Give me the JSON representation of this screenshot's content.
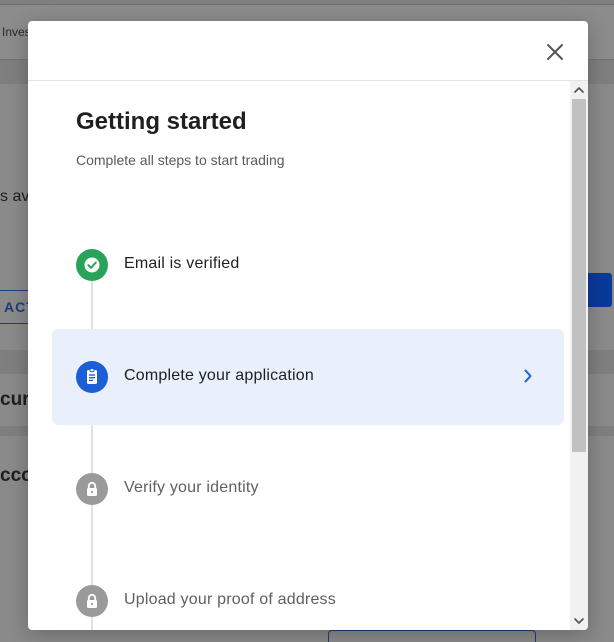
{
  "background_page": {
    "topbar_text": "Inves",
    "fragment_1": "s av",
    "act_button_label": "ACT",
    "heading_fragment_2": "cure",
    "heading_fragment_3": "cco"
  },
  "modal": {
    "title": "Getting started",
    "subtitle": "Complete all steps to start trading",
    "steps": [
      {
        "label": "Email is verified",
        "status": "completed",
        "icon": "check-circle-icon"
      },
      {
        "label": "Complete your application",
        "status": "active",
        "icon": "document-icon"
      },
      {
        "label": "Verify your identity",
        "status": "locked",
        "icon": "lock-icon"
      },
      {
        "label": "Upload your proof of address",
        "status": "locked",
        "icon": "lock-icon"
      }
    ]
  },
  "colors": {
    "completed": "#2aa35a",
    "active": "#1a5fd6",
    "active_row_bg": "#e9f0fc",
    "locked": "#9a9a9a",
    "locked_text": "#5f5f5f"
  }
}
